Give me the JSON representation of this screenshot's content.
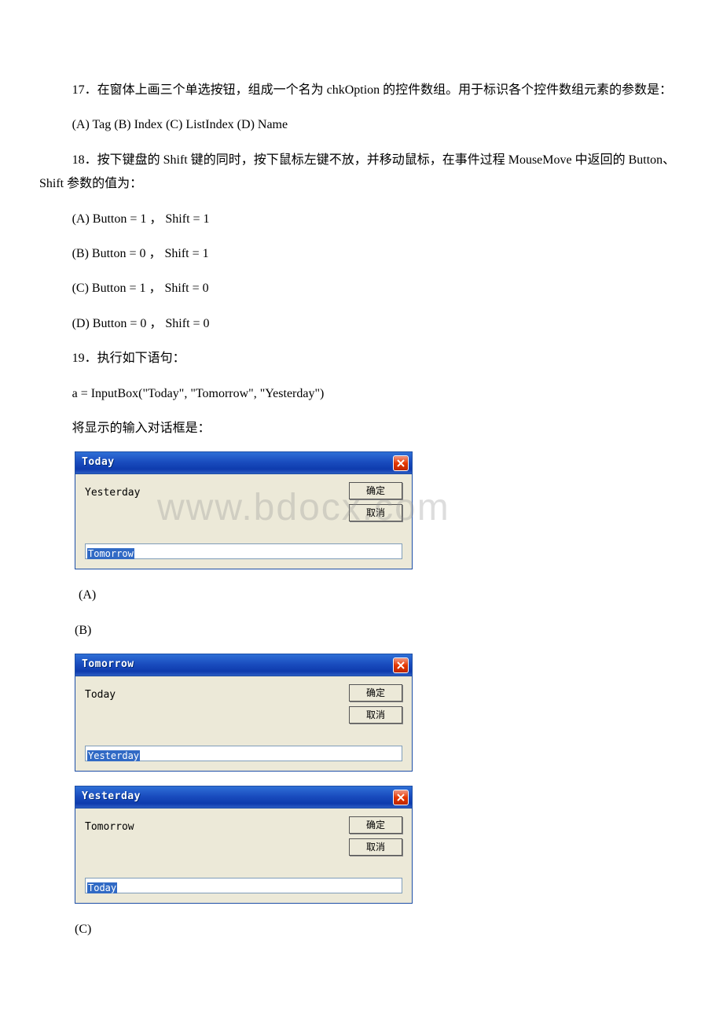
{
  "q17": {
    "text": "17．在窗体上画三个单选按钮，组成一个名为 chkOption 的控件数组。用于标识各个控件数组元素的参数是：",
    "opts": "(A) Tag (B) Index (C) ListIndex (D) Name"
  },
  "q18": {
    "text": "18．按下键盘的 Shift 键的同时，按下鼠标左键不放，并移动鼠标，在事件过程 MouseMove 中返回的 Button、Shift 参数的值为：",
    "a": "(A) Button = 1 ， Shift = 1",
    "b": "(B) Button = 0 ， Shift = 1",
    "c": "(C) Button = 1 ， Shift = 0",
    "d": "(D) Button = 0 ， Shift = 0"
  },
  "q19": {
    "intro": "19．执行如下语句：",
    "code": "a = InputBox(\"Today\", \"Tomorrow\", \"Yesterday\")",
    "tail": "将显示的输入对话框是："
  },
  "labels": {
    "A": " (A)",
    "B": "(B)",
    "C": "(C)"
  },
  "buttons": {
    "ok": "确定",
    "cancel": "取消"
  },
  "dlg1": {
    "title": "Today",
    "prompt": "Yesterday",
    "default": "Tomorrow"
  },
  "dlg2": {
    "title": "Tomorrow",
    "prompt": "Today",
    "default": "Yesterday"
  },
  "dlg3": {
    "title": "Yesterday",
    "prompt": "Tomorrow",
    "default": "Today"
  },
  "watermark": "www.bdocx.com"
}
